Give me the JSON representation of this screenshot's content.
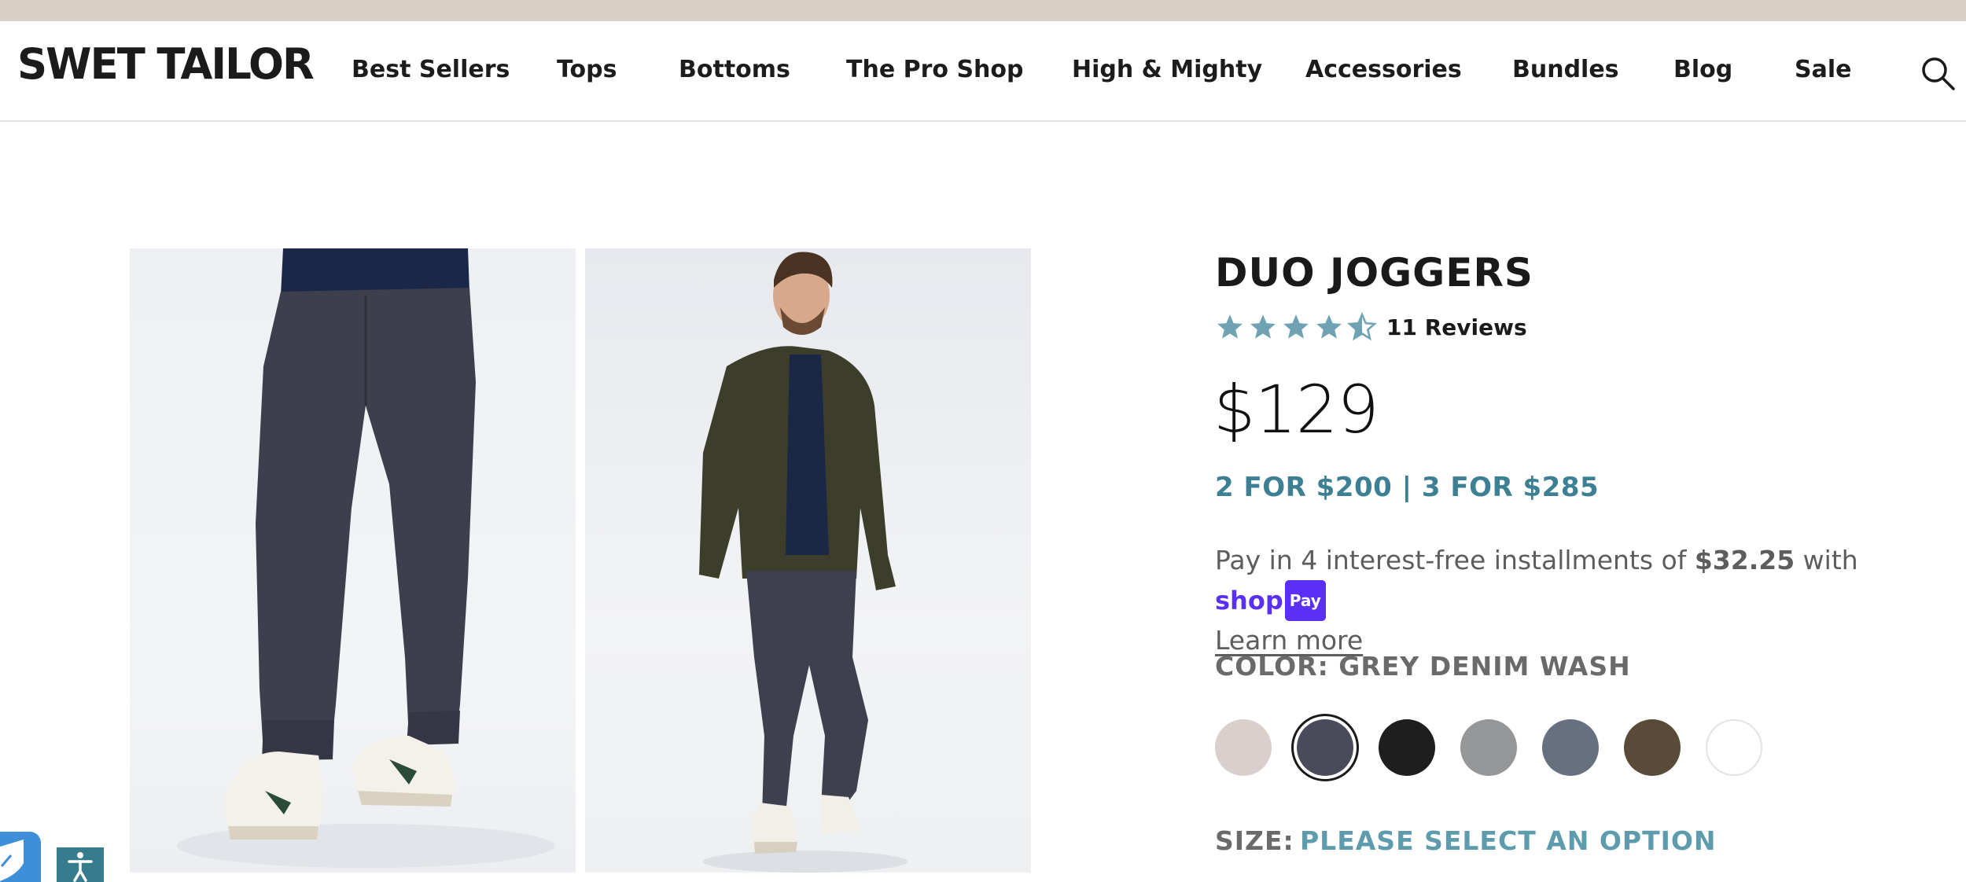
{
  "brand": {
    "logo_text": "SWET TAILOR"
  },
  "nav": {
    "items": [
      {
        "label": "Best Sellers"
      },
      {
        "label": "Tops"
      },
      {
        "label": "Bottoms"
      },
      {
        "label": "The Pro Shop"
      },
      {
        "label": "High & Mighty"
      },
      {
        "label": "Accessories"
      },
      {
        "label": "Bundles"
      },
      {
        "label": "Blog"
      },
      {
        "label": "Sale"
      }
    ],
    "search_icon": "search-icon"
  },
  "product": {
    "title": "DUO JOGGERS",
    "rating": 4.5,
    "rating_max": 5,
    "reviews_label": "11 Reviews",
    "price": "$129",
    "bundle_offer": "2 FOR $200 | 3 FOR $285",
    "installments": {
      "prefix": "Pay in 4 interest-free installments of ",
      "amount": "$32.25",
      "suffix": " with ",
      "provider": "shop",
      "provider_badge": "Pay",
      "learn_more": "Learn more"
    },
    "color_label": "COLOR: GREY DENIM WASH",
    "colors": [
      {
        "hex": "#d9cfcd"
      },
      {
        "hex": "#4a4b5a",
        "selected": true
      },
      {
        "hex": "#1e1e1f"
      },
      {
        "hex": "#959698"
      },
      {
        "hex": "#66707f"
      },
      {
        "hex": "#594b37"
      },
      {
        "hex": "#ffffff"
      }
    ],
    "size_label": "SIZE:",
    "size_value": "PLEASE SELECT AN OPTION"
  },
  "colors": {
    "accent": "#3d7f93",
    "star": "#6fa3b4",
    "promo_strip": "#d8d0c4",
    "shop_pay": "#5a31f4"
  },
  "widgets": {
    "shield_icon": "shield-icon",
    "accessibility_icon": "accessibility-icon"
  }
}
